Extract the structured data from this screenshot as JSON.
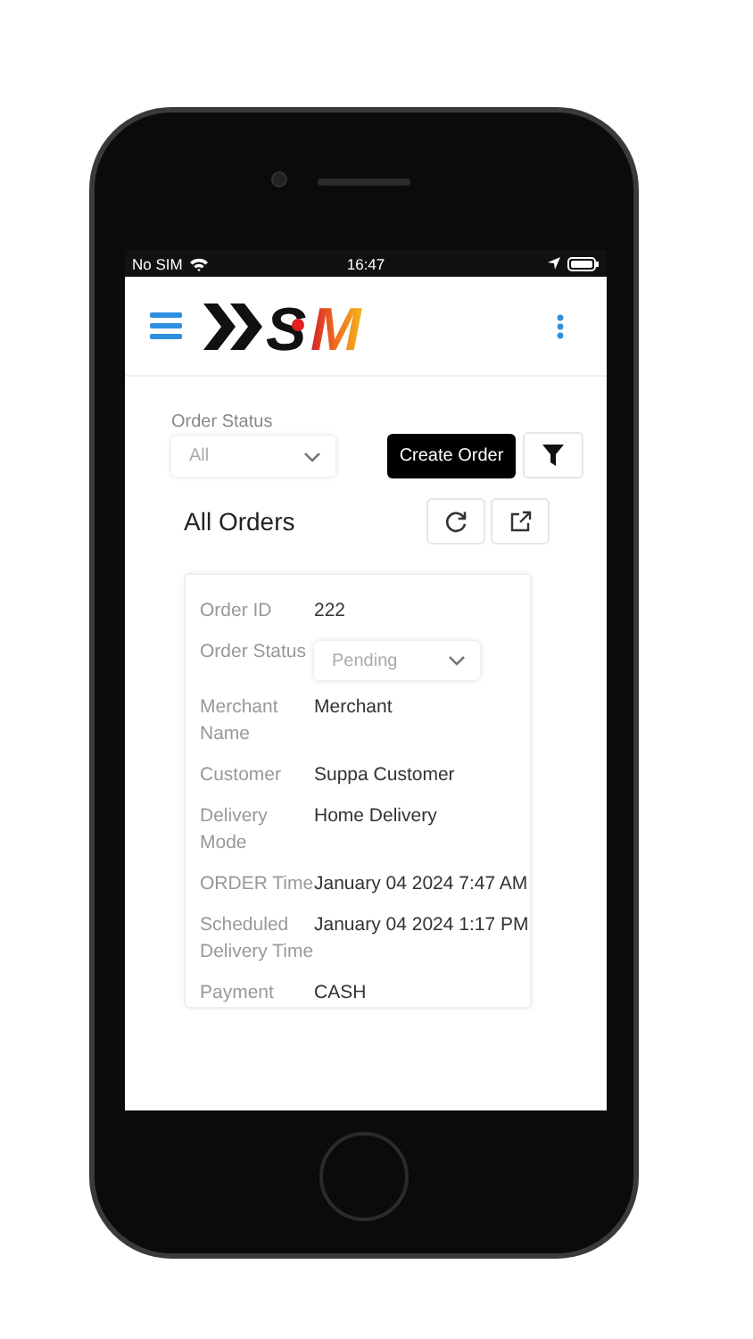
{
  "status_bar": {
    "carrier": "No SIM",
    "time": "16:47"
  },
  "header": {
    "logo_text": [
      "S",
      "M"
    ]
  },
  "filter": {
    "label": "Order Status",
    "value": "All",
    "create_button": "Create Order"
  },
  "orders": {
    "title": "All Orders"
  },
  "card": {
    "fields": [
      {
        "label": "Order ID",
        "value": "222",
        "kind": "text"
      },
      {
        "label": "Order Status",
        "value": "Pending",
        "kind": "select"
      },
      {
        "label": "Merchant Name",
        "value": "Merchant",
        "kind": "text"
      },
      {
        "label": "Customer",
        "value": "Suppa Customer",
        "kind": "text"
      },
      {
        "label": "Delivery Mode",
        "value": "Home Delivery",
        "kind": "text"
      },
      {
        "label": "ORDER Time",
        "value": "January 04 2024 7:47 AM",
        "kind": "text"
      },
      {
        "label": "Scheduled Delivery Time",
        "value": "January 04 2024 1:17 PM",
        "kind": "text"
      },
      {
        "label": "Payment",
        "value": "CASH",
        "kind": "text"
      }
    ]
  }
}
